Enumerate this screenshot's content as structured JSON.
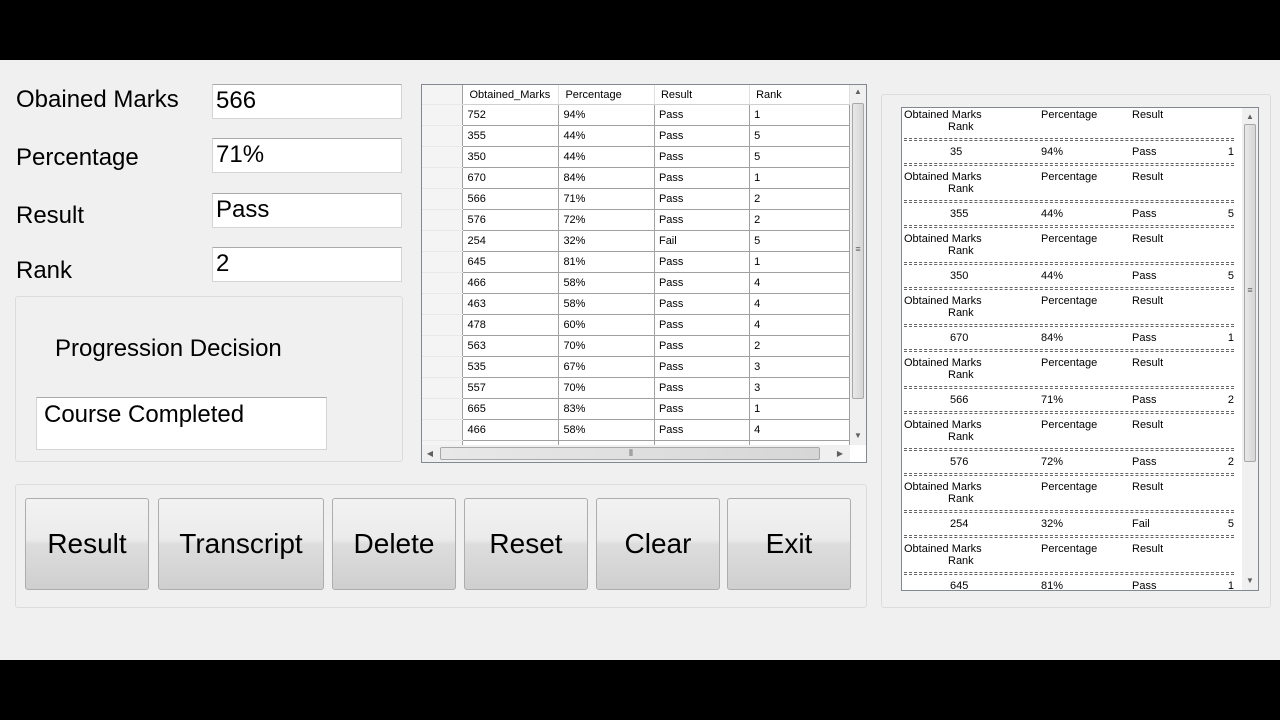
{
  "fields": {
    "obtained_marks": {
      "label": "Obained Marks",
      "value": "566"
    },
    "percentage": {
      "label": "Percentage",
      "value": "71%"
    },
    "result": {
      "label": "Result",
      "value": "Pass"
    },
    "rank": {
      "label": "Rank",
      "value": "2"
    }
  },
  "progression": {
    "title": "Progression Decision",
    "value": "Course Completed"
  },
  "buttons": {
    "result": "Result",
    "transcript": "Transcript",
    "delete": "Delete",
    "reset": "Reset",
    "clear": "Clear",
    "exit": "Exit"
  },
  "grid": {
    "columns": [
      "Obtained_Marks",
      "Percentage",
      "Result",
      "Rank"
    ],
    "rows": [
      [
        "752",
        "94%",
        "Pass",
        "1"
      ],
      [
        "355",
        "44%",
        "Pass",
        "5"
      ],
      [
        "350",
        "44%",
        "Pass",
        "5"
      ],
      [
        "670",
        "84%",
        "Pass",
        "1"
      ],
      [
        "566",
        "71%",
        "Pass",
        "2"
      ],
      [
        "576",
        "72%",
        "Pass",
        "2"
      ],
      [
        "254",
        "32%",
        "Fail",
        "5"
      ],
      [
        "645",
        "81%",
        "Pass",
        "1"
      ],
      [
        "466",
        "58%",
        "Pass",
        "4"
      ],
      [
        "463",
        "58%",
        "Pass",
        "4"
      ],
      [
        "478",
        "60%",
        "Pass",
        "4"
      ],
      [
        "563",
        "70%",
        "Pass",
        "2"
      ],
      [
        "535",
        "67%",
        "Pass",
        "3"
      ],
      [
        "557",
        "70%",
        "Pass",
        "3"
      ],
      [
        "665",
        "83%",
        "Pass",
        "1"
      ],
      [
        "466",
        "58%",
        "Pass",
        "4"
      ],
      [
        "",
        "",
        "",
        ""
      ]
    ]
  },
  "transcript": {
    "header": {
      "obtained_marks": "Obtained Marks",
      "rank": "Rank",
      "percentage": "Percentage",
      "result": "Result"
    },
    "entries": [
      {
        "marks": "35",
        "percentage": "94%",
        "result": "Pass",
        "rank": "1"
      },
      {
        "marks": "355",
        "percentage": "44%",
        "result": "Pass",
        "rank": "5"
      },
      {
        "marks": "350",
        "percentage": "44%",
        "result": "Pass",
        "rank": "5"
      },
      {
        "marks": "670",
        "percentage": "84%",
        "result": "Pass",
        "rank": "1"
      },
      {
        "marks": "566",
        "percentage": "71%",
        "result": "Pass",
        "rank": "2"
      },
      {
        "marks": "576",
        "percentage": "72%",
        "result": "Pass",
        "rank": "2"
      },
      {
        "marks": "254",
        "percentage": "32%",
        "result": "Fail",
        "rank": "5"
      },
      {
        "marks": "645",
        "percentage": "81%",
        "result": "Pass",
        "rank": "1"
      }
    ]
  },
  "icons": {
    "scroll_up": "▲",
    "scroll_down": "▼",
    "scroll_left": "◀",
    "scroll_right": "▶",
    "grip_v": "≡",
    "grip_h": "⦀"
  }
}
